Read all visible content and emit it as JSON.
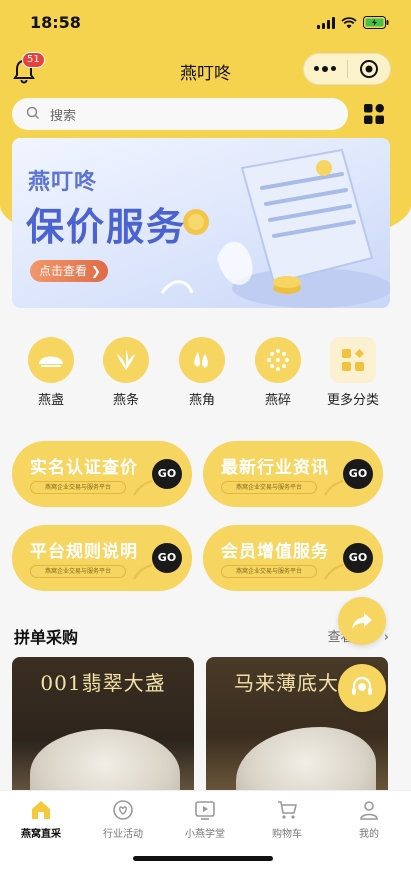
{
  "status": {
    "time": "18:58"
  },
  "nav": {
    "title": "燕叮咚",
    "notification_count": "51"
  },
  "search": {
    "placeholder": "搜索"
  },
  "banner": {
    "brand": "燕叮咚",
    "headline": "保价服务",
    "button": "点击查看 ❯"
  },
  "categories": [
    {
      "label": "燕盏",
      "icon": "nest-icon"
    },
    {
      "label": "燕条",
      "icon": "strip-icon"
    },
    {
      "label": "燕角",
      "icon": "drop-icon"
    },
    {
      "label": "燕碎",
      "icon": "fragment-icon"
    },
    {
      "label": "更多分类",
      "icon": "more-categories-icon"
    }
  ],
  "services": [
    {
      "title": "实名认证查价",
      "sub": "燕窝企业交易与服务平台",
      "go": "GO"
    },
    {
      "title": "最新行业资讯",
      "sub": "燕窝企业交易与服务平台",
      "go": "GO"
    },
    {
      "title": "平台规则说明",
      "sub": "燕窝企业交易与服务平台",
      "go": "GO"
    },
    {
      "title": "会员增值服务",
      "sub": "燕窝企业交易与服务平台",
      "go": "GO"
    }
  ],
  "group_buy": {
    "title": "拼单采购",
    "more": "查看更多 ›",
    "items": [
      {
        "name": "001翡翠大盏"
      },
      {
        "name": "马来薄底大盏"
      }
    ]
  },
  "tabbar": [
    {
      "label": "燕窝直采",
      "icon": "home-icon"
    },
    {
      "label": "行业活动",
      "icon": "activity-icon"
    },
    {
      "label": "小燕学堂",
      "icon": "video-icon"
    },
    {
      "label": "购物车",
      "icon": "cart-icon"
    },
    {
      "label": "我的",
      "icon": "profile-icon"
    }
  ],
  "colors": {
    "accent": "#f6d34f",
    "badge": "#e8403b",
    "banner_text": "#4a63d0"
  }
}
